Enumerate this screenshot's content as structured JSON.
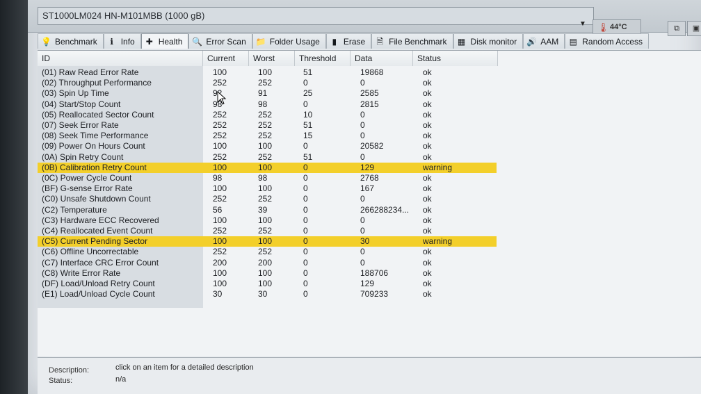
{
  "drive": {
    "name": "ST1000LM024 HN-M101MBB (1000 gB)",
    "temperature": "44°C"
  },
  "tabs": [
    {
      "label": "Benchmark",
      "icon": "benchmark-icon",
      "glyph": "💡"
    },
    {
      "label": "Info",
      "icon": "info-icon",
      "glyph": "ℹ"
    },
    {
      "label": "Health",
      "icon": "health-icon",
      "glyph": "✚"
    },
    {
      "label": "Error Scan",
      "icon": "error-scan-icon",
      "glyph": "🔍"
    },
    {
      "label": "Folder Usage",
      "icon": "folder-icon",
      "glyph": "📁"
    },
    {
      "label": "Erase",
      "icon": "erase-icon",
      "glyph": "▮"
    },
    {
      "label": "File Benchmark",
      "icon": "file-benchmark-icon",
      "glyph": "🗎"
    },
    {
      "label": "Disk monitor",
      "icon": "disk-monitor-icon",
      "glyph": "▦"
    },
    {
      "label": "AAM",
      "icon": "speaker-icon",
      "glyph": "🔊"
    },
    {
      "label": "Random Access",
      "icon": "random-access-icon",
      "glyph": "▤"
    }
  ],
  "columns": {
    "id": "ID",
    "current": "Current",
    "worst": "Worst",
    "threshold": "Threshold",
    "data": "Data",
    "status": "Status"
  },
  "rows": [
    {
      "id": "(01) Raw Read Error Rate",
      "current": "100",
      "worst": "100",
      "threshold": "51",
      "data": "19868",
      "status": "ok"
    },
    {
      "id": "(02) Throughput Performance",
      "current": "252",
      "worst": "252",
      "threshold": "0",
      "data": "0",
      "status": "ok"
    },
    {
      "id": "(03) Spin Up Time",
      "current": "92",
      "worst": "91",
      "threshold": "25",
      "data": "2585",
      "status": "ok"
    },
    {
      "id": "(04) Start/Stop Count",
      "current": "98",
      "worst": "98",
      "threshold": "0",
      "data": "2815",
      "status": "ok"
    },
    {
      "id": "(05) Reallocated Sector Count",
      "current": "252",
      "worst": "252",
      "threshold": "10",
      "data": "0",
      "status": "ok"
    },
    {
      "id": "(07) Seek Error Rate",
      "current": "252",
      "worst": "252",
      "threshold": "51",
      "data": "0",
      "status": "ok"
    },
    {
      "id": "(08) Seek Time Performance",
      "current": "252",
      "worst": "252",
      "threshold": "15",
      "data": "0",
      "status": "ok"
    },
    {
      "id": "(09) Power On Hours Count",
      "current": "100",
      "worst": "100",
      "threshold": "0",
      "data": "20582",
      "status": "ok"
    },
    {
      "id": "(0A) Spin Retry Count",
      "current": "252",
      "worst": "252",
      "threshold": "51",
      "data": "0",
      "status": "ok"
    },
    {
      "id": "(0B) Calibration Retry Count",
      "current": "100",
      "worst": "100",
      "threshold": "0",
      "data": "129",
      "status": "warning",
      "warn": true
    },
    {
      "id": "(0C) Power Cycle Count",
      "current": "98",
      "worst": "98",
      "threshold": "0",
      "data": "2768",
      "status": "ok"
    },
    {
      "id": "(BF) G-sense Error Rate",
      "current": "100",
      "worst": "100",
      "threshold": "0",
      "data": "167",
      "status": "ok"
    },
    {
      "id": "(C0) Unsafe Shutdown Count",
      "current": "252",
      "worst": "252",
      "threshold": "0",
      "data": "0",
      "status": "ok"
    },
    {
      "id": "(C2) Temperature",
      "current": "56",
      "worst": "39",
      "threshold": "0",
      "data": "266288234...",
      "status": "ok"
    },
    {
      "id": "(C3) Hardware ECC Recovered",
      "current": "100",
      "worst": "100",
      "threshold": "0",
      "data": "0",
      "status": "ok"
    },
    {
      "id": "(C4) Reallocated Event Count",
      "current": "252",
      "worst": "252",
      "threshold": "0",
      "data": "0",
      "status": "ok"
    },
    {
      "id": "(C5) Current Pending Sector",
      "current": "100",
      "worst": "100",
      "threshold": "0",
      "data": "30",
      "status": "warning",
      "warn": true
    },
    {
      "id": "(C6) Offline Uncorrectable",
      "current": "252",
      "worst": "252",
      "threshold": "0",
      "data": "0",
      "status": "ok"
    },
    {
      "id": "(C7) Interface CRC Error Count",
      "current": "200",
      "worst": "200",
      "threshold": "0",
      "data": "0",
      "status": "ok"
    },
    {
      "id": "(C8) Write Error Rate",
      "current": "100",
      "worst": "100",
      "threshold": "0",
      "data": "188706",
      "status": "ok"
    },
    {
      "id": "(DF) Load/Unload Retry Count",
      "current": "100",
      "worst": "100",
      "threshold": "0",
      "data": "129",
      "status": "ok"
    },
    {
      "id": "(E1) Load/Unload Cycle Count",
      "current": "30",
      "worst": "30",
      "threshold": "0",
      "data": "709233",
      "status": "ok"
    }
  ],
  "description": {
    "desc_label": "Description:",
    "desc_value": "click on an item for a detailed description",
    "status_label": "Status:",
    "status_value": "n/a"
  },
  "colors": {
    "warning_row": "#f3cf2a",
    "window_bg": "#e4e8ec"
  }
}
